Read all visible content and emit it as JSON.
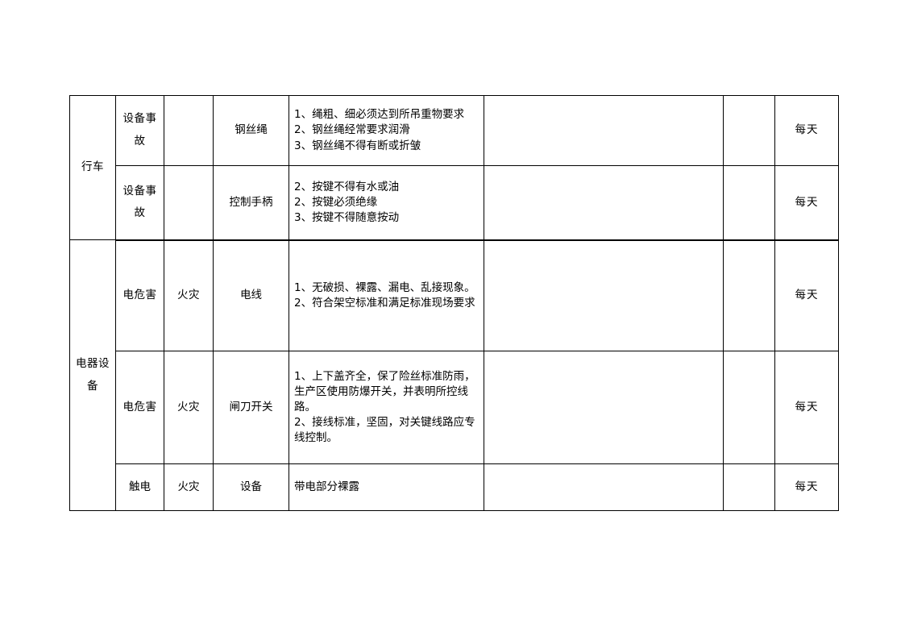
{
  "document": {
    "type": "safety-inspection-table",
    "page_background": "#ffffff",
    "border_color": "#000000"
  },
  "table": {
    "columns": [
      {
        "key": "category",
        "name": "category-column"
      },
      {
        "key": "risk",
        "name": "risk-type-column"
      },
      {
        "key": "accident",
        "name": "accident-type-column"
      },
      {
        "key": "object",
        "name": "inspection-object-column"
      },
      {
        "key": "standard",
        "name": "inspection-standard-column"
      },
      {
        "key": "result",
        "name": "result-column"
      },
      {
        "key": "inspector",
        "name": "inspector-column"
      },
      {
        "key": "frequency",
        "name": "frequency-column"
      }
    ],
    "groups": [
      {
        "label": "行车",
        "rows": 2
      },
      {
        "label": "电器设备",
        "rows": 3
      }
    ],
    "rows": [
      {
        "group": "行车",
        "risk": "设备事故",
        "accident": "",
        "object": "钢丝绳",
        "standard": "1、绳粗、细必须达到所吊重物要求\n2、钢丝绳经常要求润滑\n3、钢丝绳不得有断或折皱",
        "result": "",
        "inspector": "",
        "frequency": "每天"
      },
      {
        "group": "行车",
        "risk": "设备事故",
        "accident": "",
        "object": "控制手柄",
        "standard": "2、按键不得有水或油\n2、按键必须绝缘\n3、按键不得随意按动",
        "result": "",
        "inspector": "",
        "frequency": "每天"
      },
      {
        "group": "电器设备",
        "risk": "电危害",
        "accident": "火灾",
        "object": "电线",
        "standard": "1、无破损、裸露、漏电、乱接现象。\n2、符合架空标准和满足标准现场要求",
        "result": "",
        "inspector": "",
        "frequency": "每天"
      },
      {
        "group": "电器设备",
        "risk": "电危害",
        "accident": "火灾",
        "object": "闸刀开关",
        "standard": "1、上下盖齐全，保了险丝标准防雨，生产区使用防爆开关，并表明所控线路。\n2、接线标准，坚固，对关键线路应专线控制。",
        "result": "",
        "inspector": "",
        "frequency": "每天"
      },
      {
        "group": "电器设备",
        "risk": "触电",
        "accident": "火灾",
        "object": "设备",
        "standard": "带电部分裸露",
        "result": "",
        "inspector": "",
        "frequency": "每天"
      }
    ]
  }
}
